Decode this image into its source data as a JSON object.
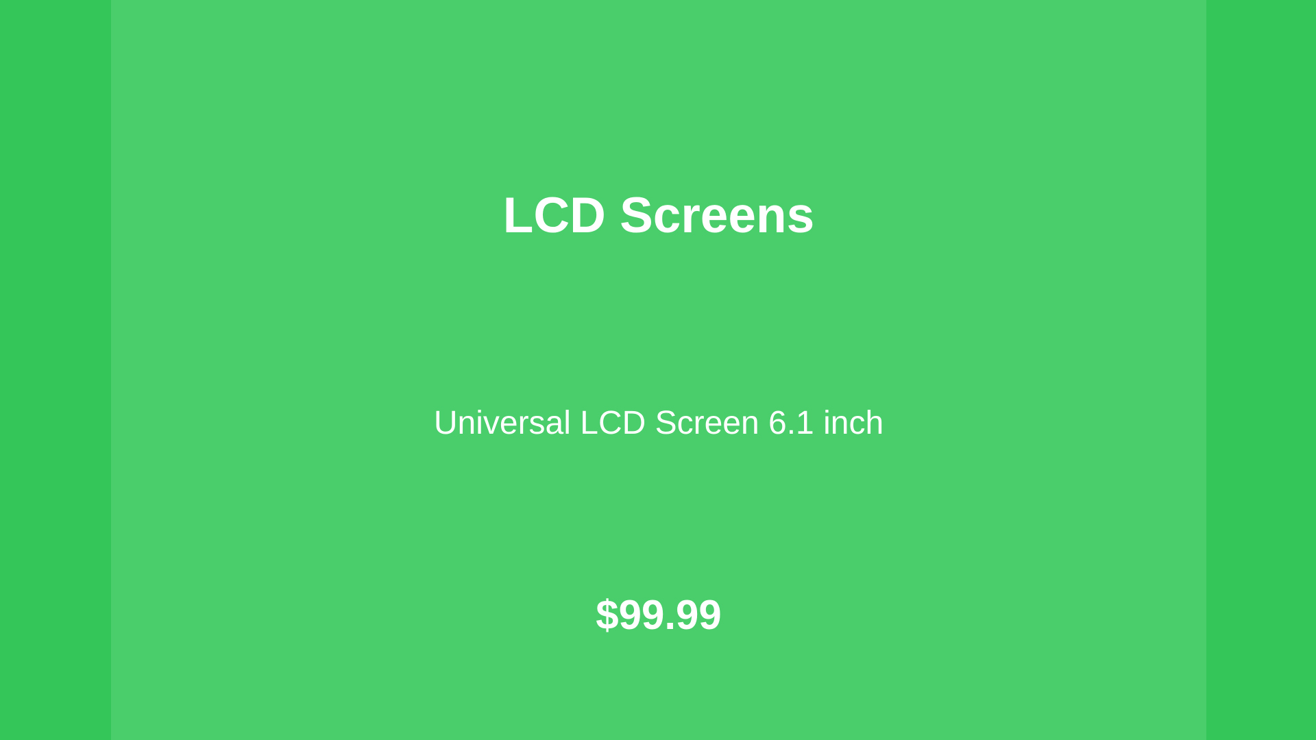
{
  "colors": {
    "background": "#34c659",
    "card": "#4ace6b",
    "text": "#ffffff"
  },
  "product": {
    "category": "LCD Screens",
    "description": "Universal LCD Screen 6.1 inch",
    "price": "$99.99"
  }
}
